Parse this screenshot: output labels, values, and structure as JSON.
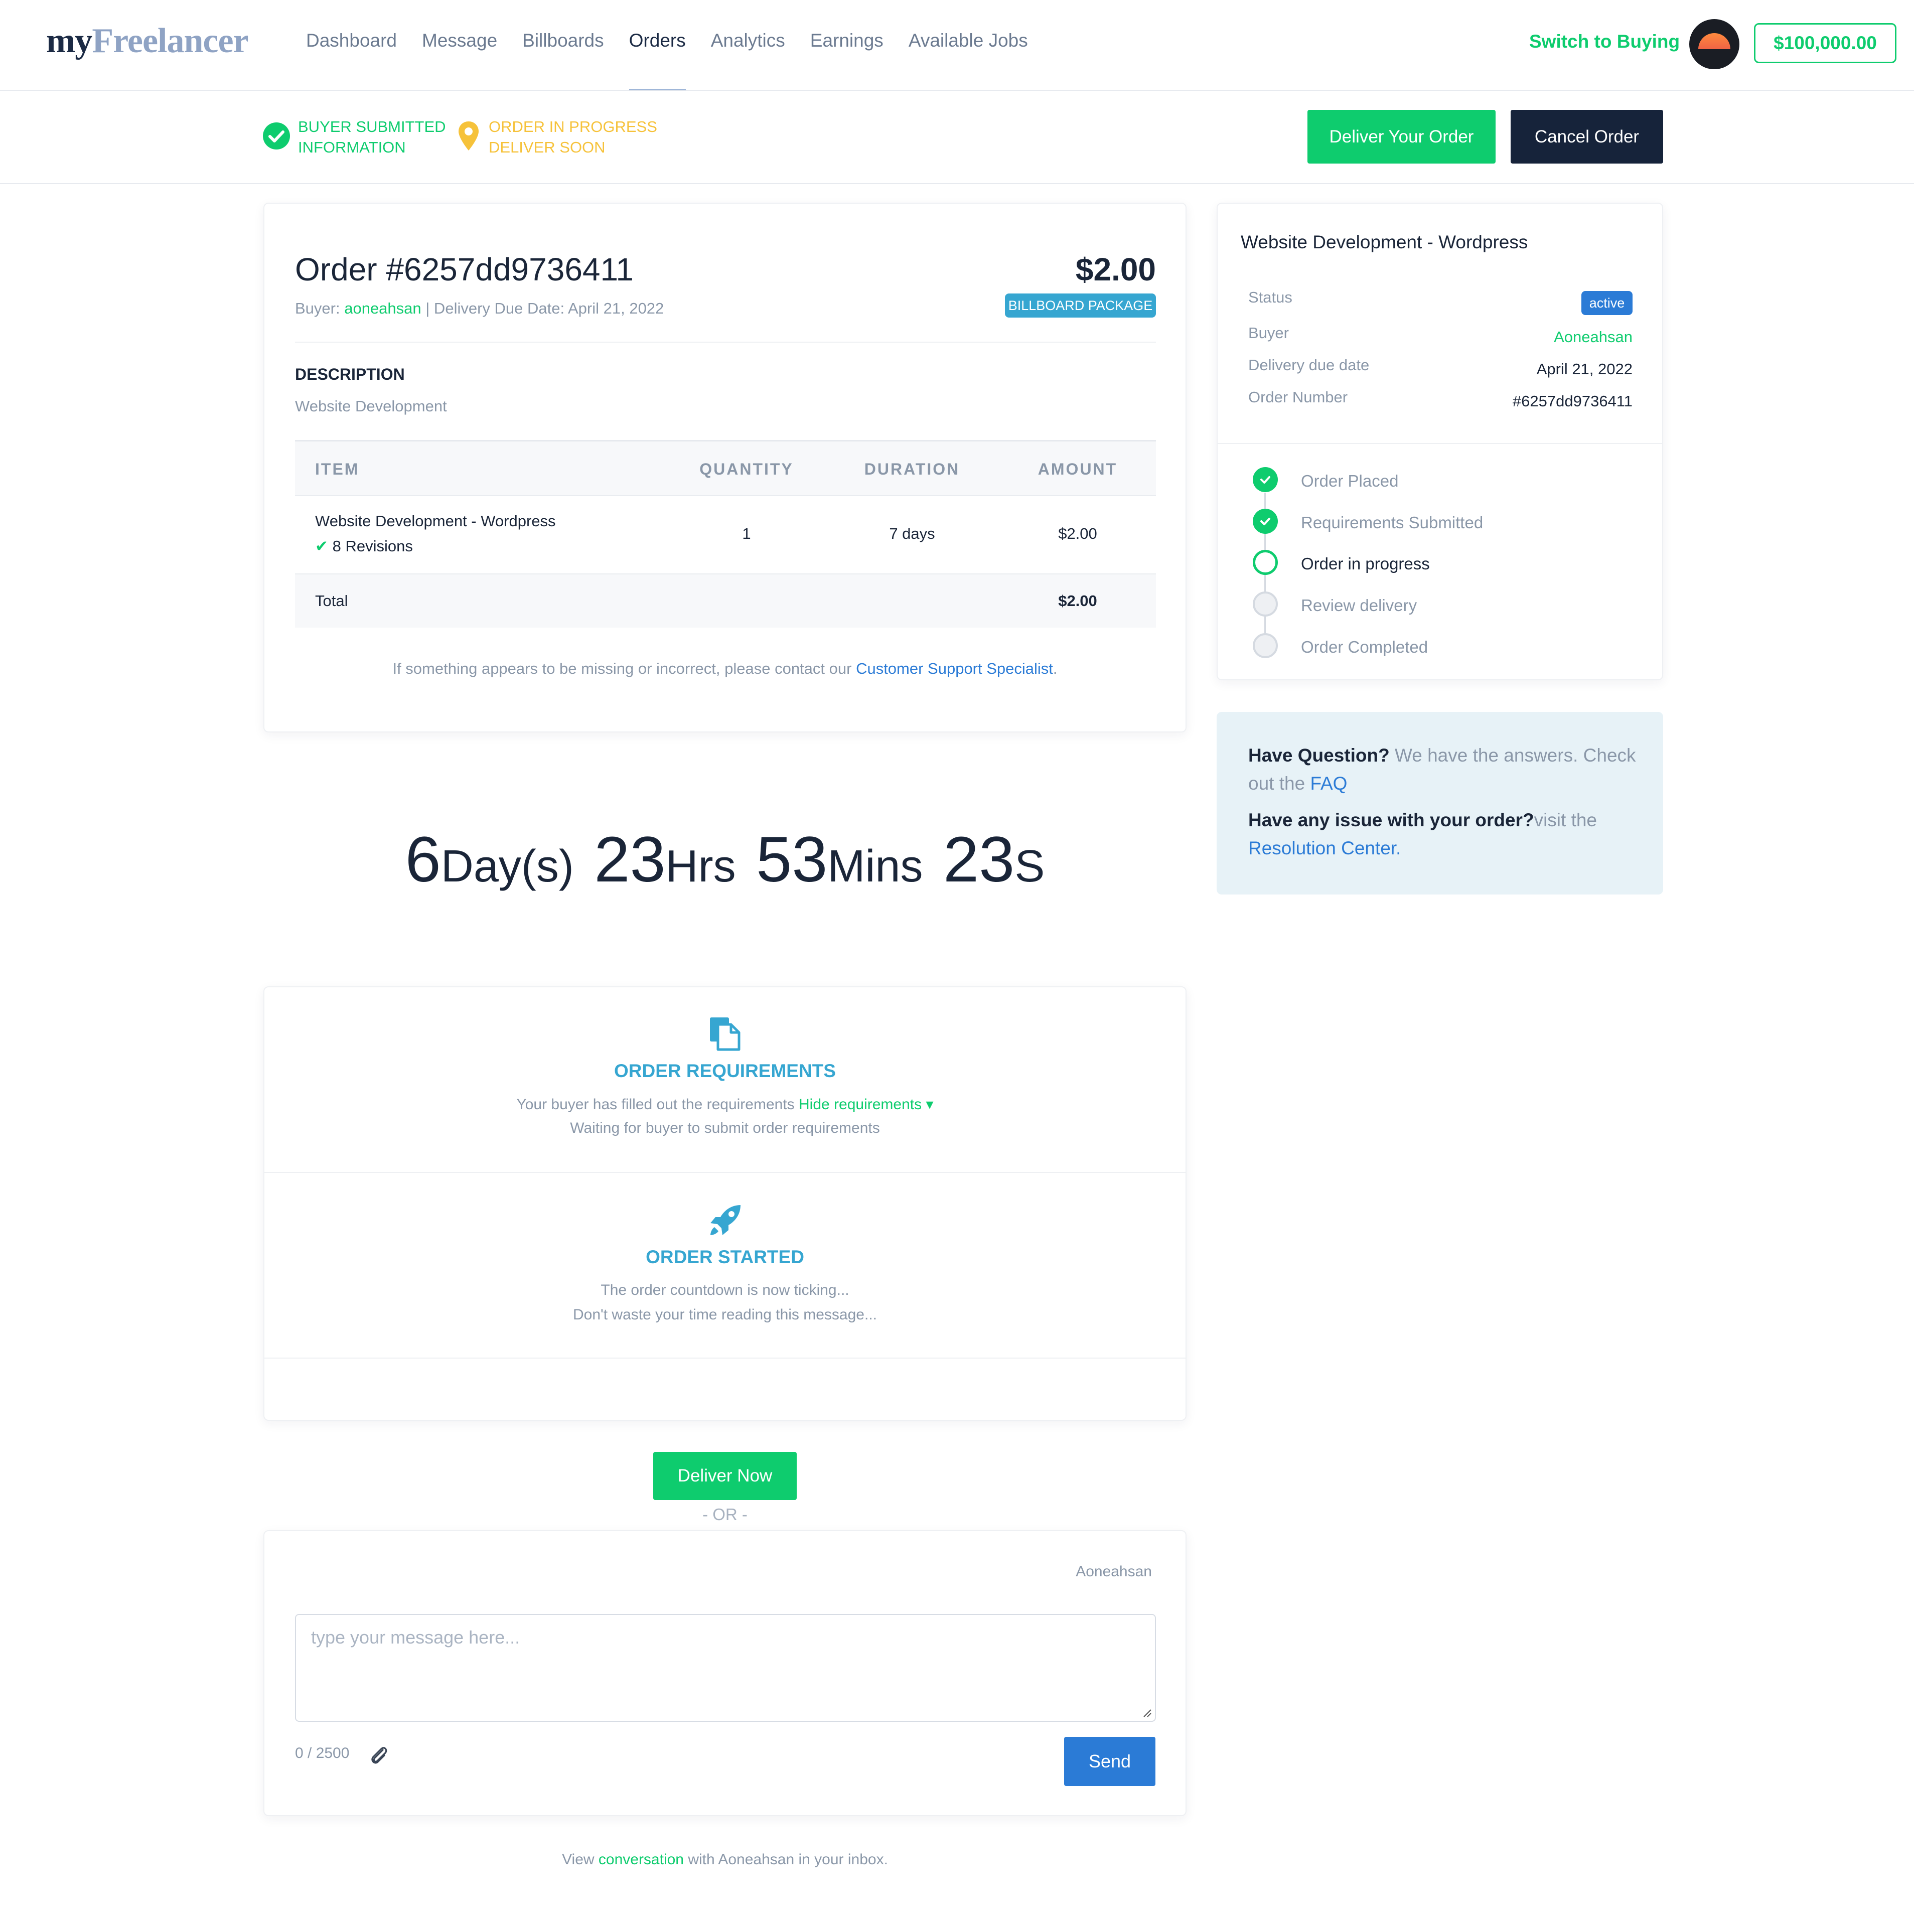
{
  "brand": {
    "logo_my": "my",
    "logo_freelancer": "Freelancer"
  },
  "nav": {
    "items": [
      {
        "label": "Dashboard",
        "active": false
      },
      {
        "label": "Message",
        "active": false
      },
      {
        "label": "Billboards",
        "active": false
      },
      {
        "label": "Orders",
        "active": true
      },
      {
        "label": "Analytics",
        "active": false
      },
      {
        "label": "Earnings",
        "active": false
      },
      {
        "label": "Available Jobs",
        "active": false
      }
    ],
    "switch_label": "Switch to Buying",
    "balance": "$100,000.00"
  },
  "status_bar": {
    "step1_line1": "Buyer submitted",
    "step1_line2": "information",
    "step2_line1": "Order in progress",
    "step2_line2": "Deliver soon",
    "deliver_button": "Deliver Your Order",
    "cancel_button": "Cancel Order"
  },
  "order": {
    "title": "Order #6257dd9736411",
    "price": "$2.00",
    "package_badge": "Billboard Package",
    "buyer_prefix": "Buyer: ",
    "buyer": "aoneahsan",
    "due_text": " | Delivery Due Date: April 21, 2022",
    "description_heading": "Description",
    "description": "Website Development",
    "table": {
      "headers": [
        "Item",
        "Quantity",
        "Duration",
        "Amount"
      ],
      "row": {
        "item": "Website Development - Wordpress",
        "revisions": "8 Revisions",
        "quantity": "1",
        "duration": "7 days",
        "amount": "$2.00"
      },
      "total_label": "Total",
      "total_amount": "$2.00"
    },
    "support_text": "If something appears to be missing or incorrect, please contact our ",
    "support_link": "Customer Support Specialist",
    "support_end": "."
  },
  "countdown": {
    "days": "6",
    "days_unit": "Day(s)",
    "hours": "23",
    "hours_unit": "Hrs",
    "mins": "53",
    "mins_unit": "Mins",
    "secs": "23",
    "secs_unit": "S"
  },
  "requirements": {
    "title": "Order Requirements",
    "line1": "Your buyer has filled out the requirements ",
    "toggle": "Hide requirements",
    "line2": "Waiting for buyer to submit order requirements"
  },
  "started": {
    "title": "Order Started",
    "line1": "The order countdown is now ticking...",
    "line2": "Don't waste your time reading this message..."
  },
  "deliver_now": "Deliver Now",
  "or_text": "- OR -",
  "message": {
    "recipient": "Aoneahsan",
    "placeholder": "type your message here...",
    "char_count": "0 / 2500",
    "send": "Send"
  },
  "inbox_note": {
    "prefix": "View ",
    "link": "conversation",
    "suffix": " with Aoneahsan in your inbox."
  },
  "sidebar": {
    "title": "Website Development - Wordpress",
    "status_label": "Status",
    "status_value": "active",
    "buyer_label": "Buyer",
    "buyer_value": "Aoneahsan",
    "due_label": "Delivery due date",
    "due_value": "April 21, 2022",
    "number_label": "Order Number",
    "number_value": "#6257dd9736411",
    "timeline": [
      {
        "label": "Order Placed",
        "state": "done"
      },
      {
        "label": "Requirements Submitted",
        "state": "done"
      },
      {
        "label": "Order in progress",
        "state": "current"
      },
      {
        "label": "Review delivery",
        "state": "todo"
      },
      {
        "label": "Order Completed",
        "state": "todo"
      }
    ]
  },
  "faq": {
    "q1_strong": "Have Question?",
    "q1_text": " We have the answers. Check out the ",
    "q1_link": "FAQ",
    "q2_strong": "Have any issue with your order?",
    "q2_text": "visit the ",
    "q2_link": "Resolution Center."
  },
  "colors": {
    "green": "#0ecc6e",
    "navy": "#16233a",
    "blue": "#2b7bd6",
    "teal": "#36a6d1",
    "yellow": "#f6c23a"
  }
}
